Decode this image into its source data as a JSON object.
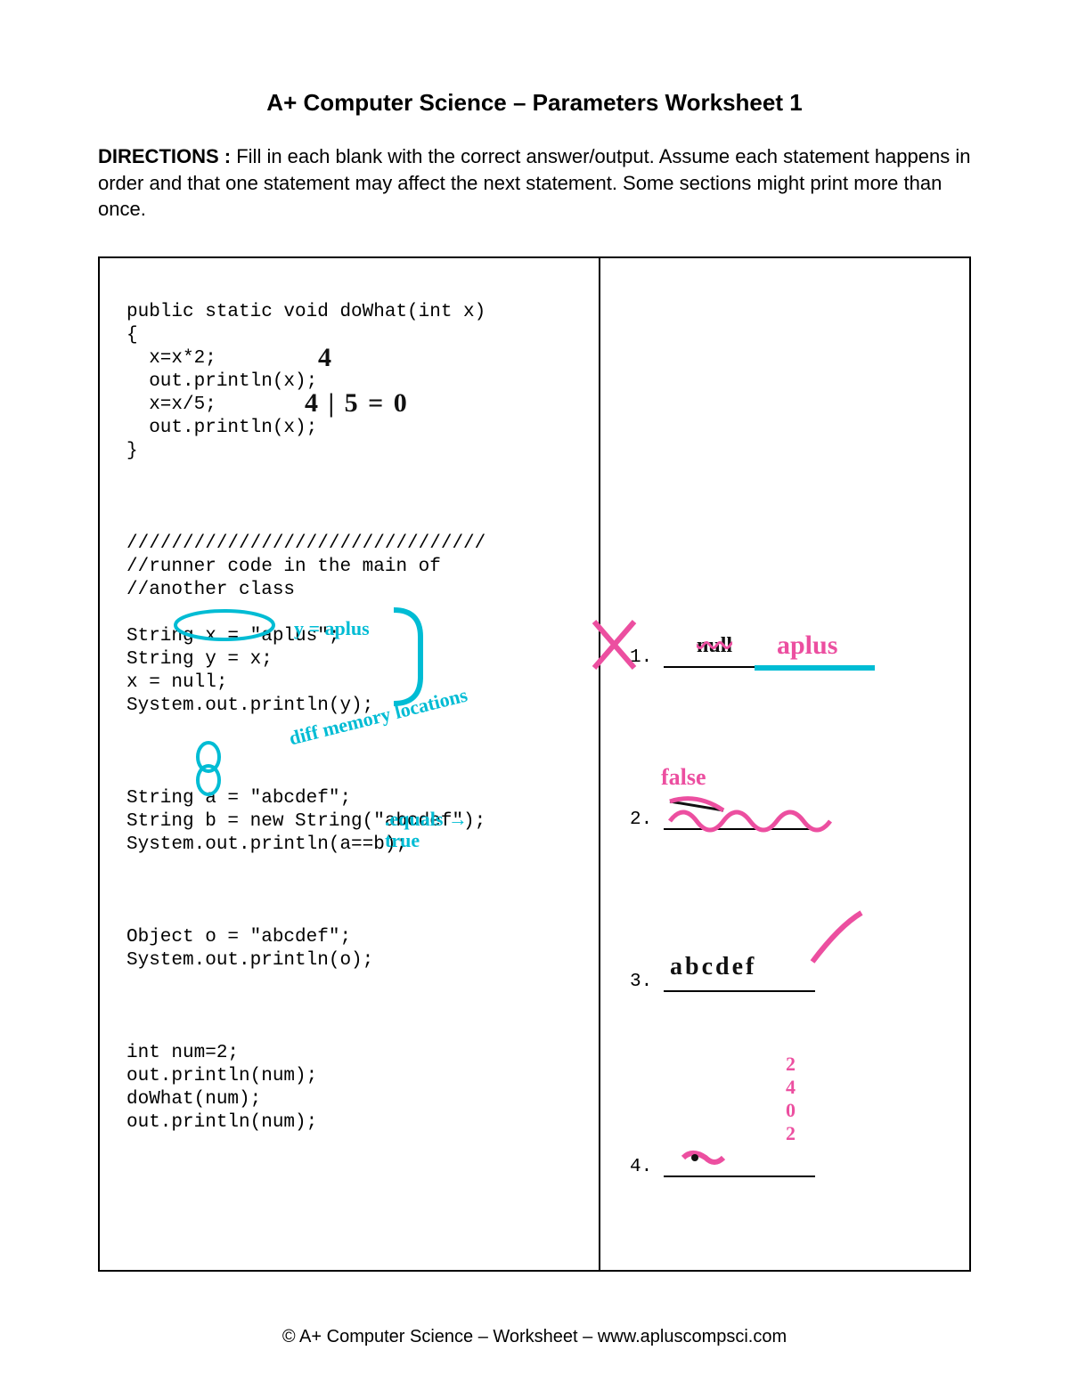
{
  "title": "A+ Computer Science – Parameters Worksheet 1",
  "directions_label": "DIRECTIONS : ",
  "directions_text": "Fill in each blank with the correct answer/output.  Assume each statement happens in order and that one statement may affect the next statement.  Some sections might print more than once.",
  "code": {
    "l1": "public static void doWhat(int x)",
    "l2": "{",
    "l3": "  x=x*2;",
    "l4": "  out.println(x);",
    "l5": "  x=x/5;",
    "l6": "  out.println(x);",
    "l7": "}",
    "l8": "////////////////////////////////",
    "l9": "//runner code in the main of",
    "l10": "//another class",
    "l11": "String x = \"aplus\";",
    "l12": "String y = x;",
    "l13": "x = null;",
    "l14": "System.out.println(y);",
    "l15": "String a = \"abcdef\";",
    "l16": "String b = new String(\"abcdef\");",
    "l17": "System.out.println(a==b);",
    "l18": "Object o = \"abcdef\";",
    "l19": "System.out.println(o);",
    "l20": "int num=2;",
    "l21": "out.println(num);",
    "l22": "doWhat(num);",
    "l23": "out.println(num);"
  },
  "answers": {
    "n1": "1.",
    "n2": "2.",
    "n3": "3.",
    "n4": "4."
  },
  "handwritten": {
    "hw1": "4",
    "hw2": "4 | 5   =   0",
    "hw3": "y = aplus",
    "hw4": "diff memory locations",
    "hw5": ".equals  → true",
    "hw6": "null",
    "hw6b": "aplus",
    "hw7": "false",
    "hw8": "abcdef",
    "hw9a": "2",
    "hw9b": "4",
    "hw9c": "0",
    "hw9d": "2"
  },
  "footer": "© A+ Computer Science – Worksheet – www.apluscompsci.com"
}
